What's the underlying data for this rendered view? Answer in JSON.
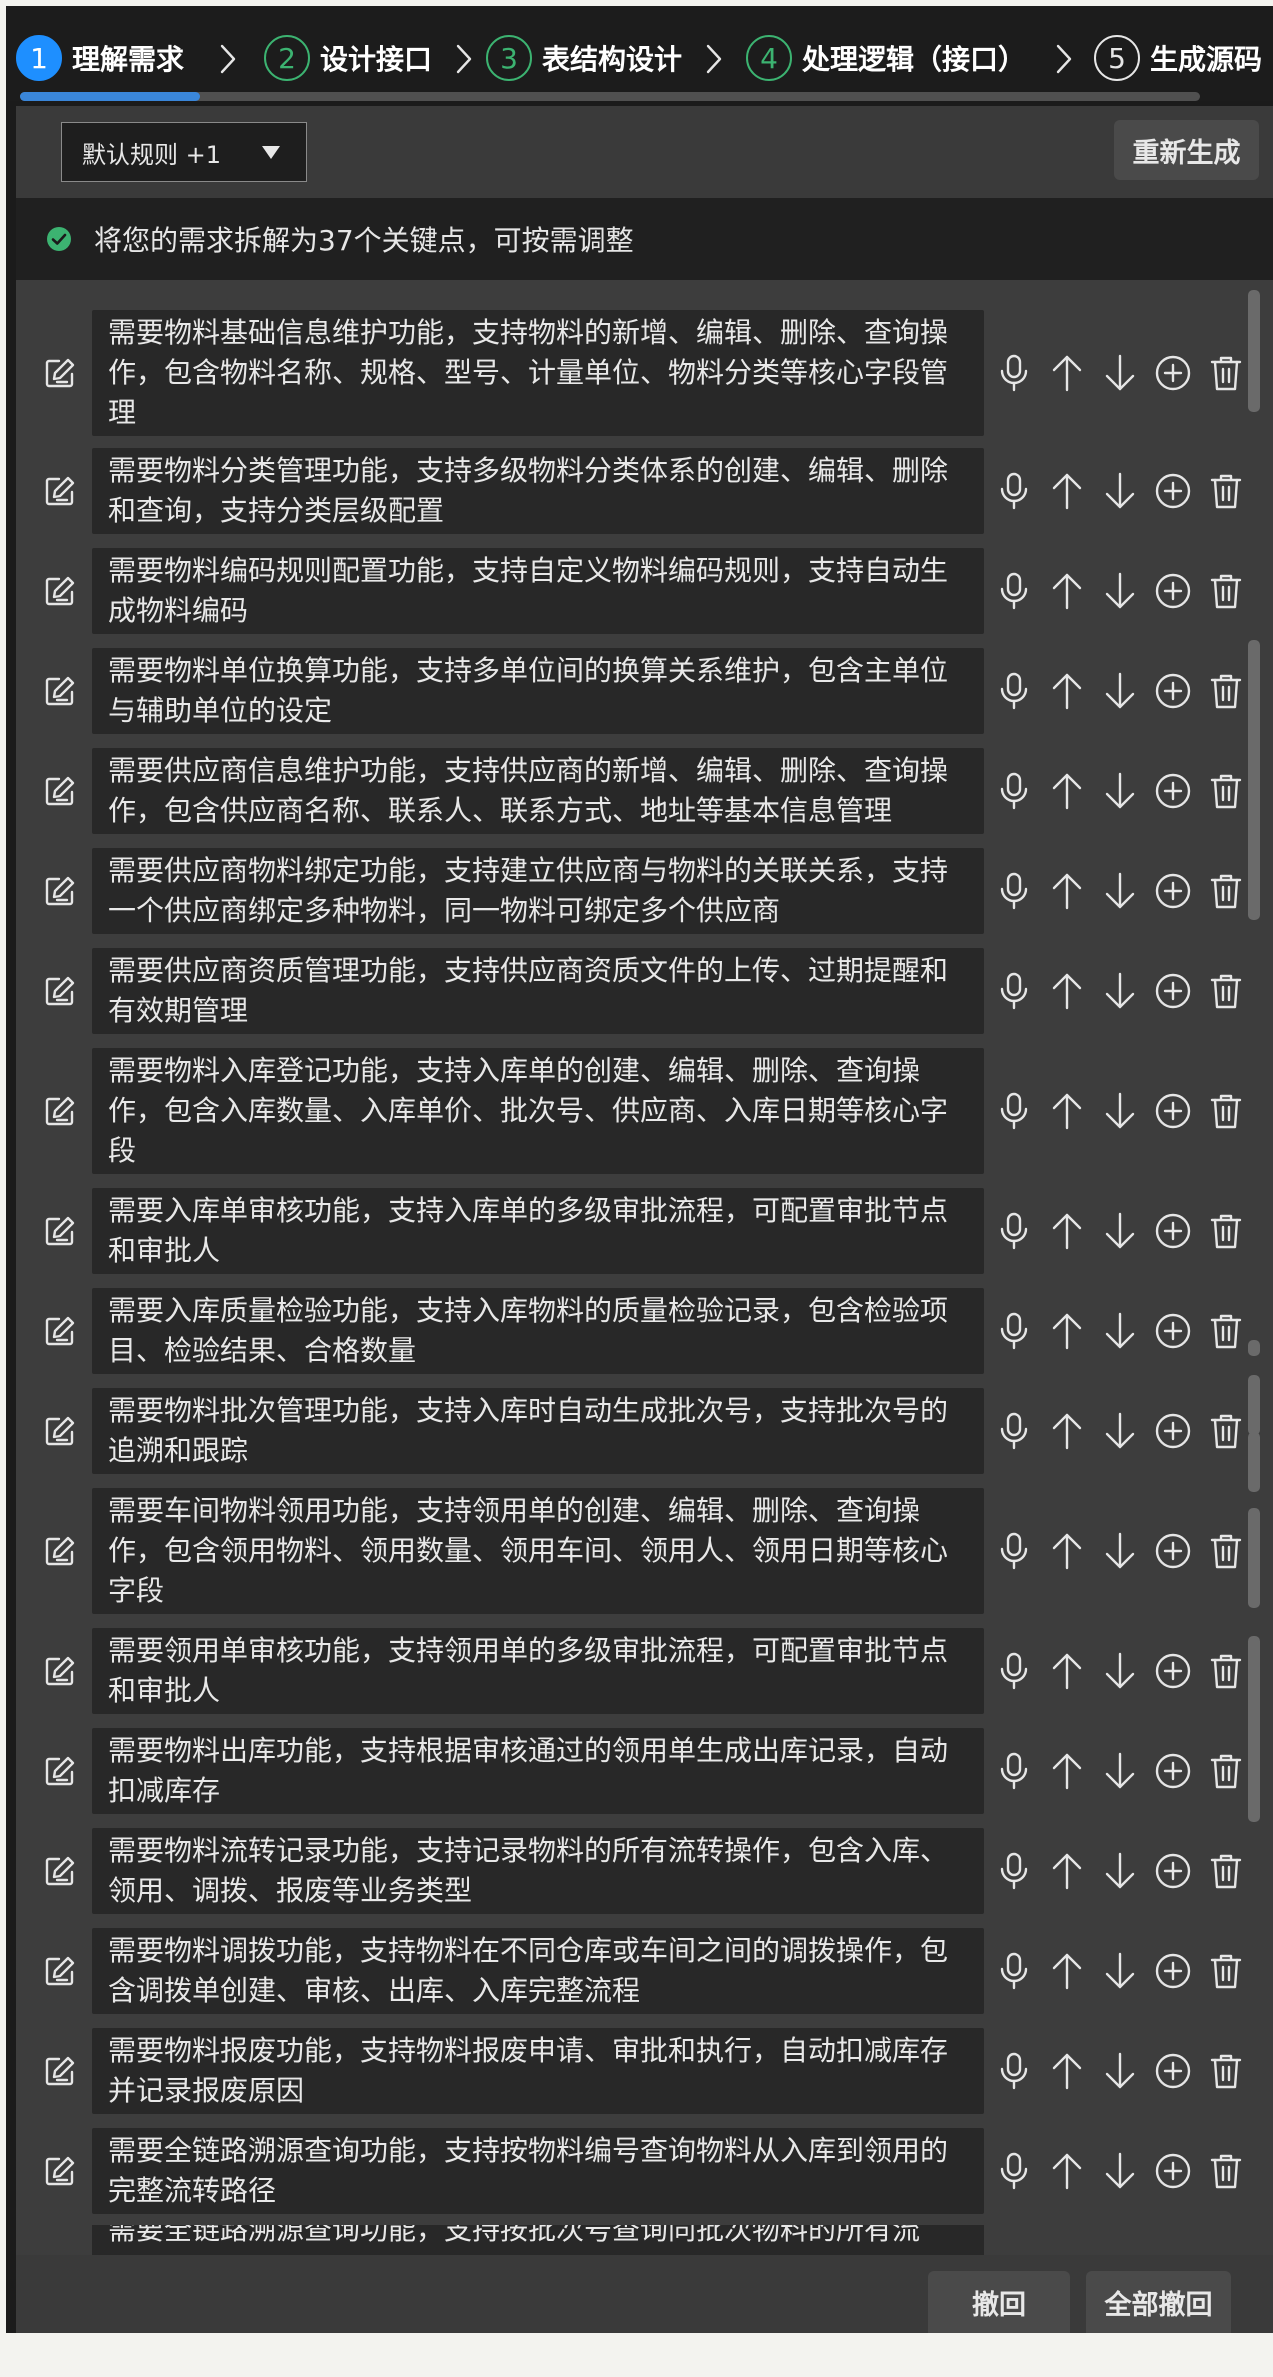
{
  "stepper": {
    "steps": [
      {
        "num": "1",
        "label": "理解需求",
        "state": "active"
      },
      {
        "num": "2",
        "label": "设计接口",
        "state": "done"
      },
      {
        "num": "3",
        "label": "表结构设计",
        "state": "done"
      },
      {
        "num": "4",
        "label": "处理逻辑（接口）",
        "state": "done"
      },
      {
        "num": "5",
        "label": "生成源码",
        "state": "pending"
      }
    ],
    "active_color": "#1e8fff",
    "done_color": "#3cb371"
  },
  "toolbar": {
    "rules_select_value": "默认规则 +1",
    "caret_icon": "caret-down-icon",
    "regenerate_label": "重新生成"
  },
  "notice": {
    "icon": "check-circle-icon",
    "text": "将您的需求拆解为37个关键点，可按需调整"
  },
  "items": [
    {
      "text": "需要物料基础信息维护功能，支持物料的新增、编辑、删除、查询操作，包含物料名称、规格、型号、计量单位、物料分类等核心字段管理"
    },
    {
      "text": "需要物料分类管理功能，支持多级物料分类体系的创建、编辑、删除和查询，支持分类层级配置"
    },
    {
      "text": "需要物料编码规则配置功能，支持自定义物料编码规则，支持自动生成物料编码"
    },
    {
      "text": "需要物料单位换算功能，支持多单位间的换算关系维护，包含主单位与辅助单位的设定"
    },
    {
      "text": "需要供应商信息维护功能，支持供应商的新增、编辑、删除、查询操作，包含供应商名称、联系人、联系方式、地址等基本信息管理"
    },
    {
      "text": "需要供应商物料绑定功能，支持建立供应商与物料的关联关系，支持一个供应商绑定多种物料，同一物料可绑定多个供应商"
    },
    {
      "text": "需要供应商资质管理功能，支持供应商资质文件的上传、过期提醒和有效期管理"
    },
    {
      "text": "需要物料入库登记功能，支持入库单的创建、编辑、删除、查询操作，包含入库数量、入库单价、批次号、供应商、入库日期等核心字段"
    },
    {
      "text": "需要入库单审核功能，支持入库单的多级审批流程，可配置审批节点和审批人"
    },
    {
      "text": "需要入库质量检验功能，支持入库物料的质量检验记录，包含检验项目、检验结果、合格数量"
    },
    {
      "text": "需要物料批次管理功能，支持入库时自动生成批次号，支持批次号的追溯和跟踪"
    },
    {
      "text": "需要车间物料领用功能，支持领用单的创建、编辑、删除、查询操作，包含领用物料、领用数量、领用车间、领用人、领用日期等核心字段"
    },
    {
      "text": "需要领用单审核功能，支持领用单的多级审批流程，可配置审批节点和审批人"
    },
    {
      "text": "需要物料出库功能，支持根据审核通过的领用单生成出库记录，自动扣减库存"
    },
    {
      "text": "需要物料流转记录功能，支持记录物料的所有流转操作，包含入库、领用、调拨、报废等业务类型"
    },
    {
      "text": "需要物料调拨功能，支持物料在不同仓库或车间之间的调拨操作，包含调拨单创建、审核、出库、入库完整流程"
    },
    {
      "text": "需要物料报废功能，支持物料报废申请、审批和执行，自动扣减库存并记录报废原因"
    },
    {
      "text": "需要全链路溯源查询功能，支持按物料编号查询物料从入库到领用的完整流转路径"
    }
  ],
  "partial_item_text": "需要全链路溯源查询功能，支持按批次号查询同批次物料的所有流",
  "item_icons": {
    "edit": "edit-icon",
    "actions": [
      "microphone-icon",
      "arrow-up-icon",
      "arrow-down-icon",
      "plus-circle-icon",
      "trash-icon"
    ]
  },
  "footer": {
    "undo_label": "撤回",
    "undo_all_label": "全部撤回"
  }
}
